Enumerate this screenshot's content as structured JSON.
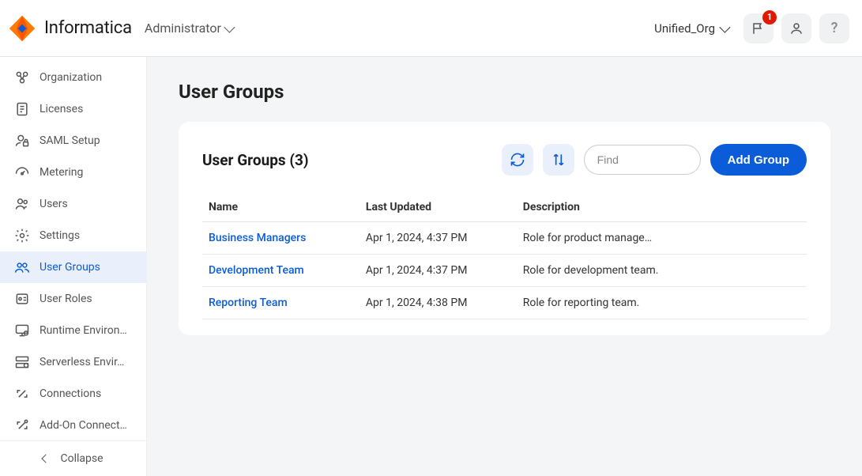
{
  "brand": "Informatica",
  "app_name": "Administrator",
  "org_name": "Unified_Org",
  "notifications_count": "1",
  "sidebar": {
    "items": [
      {
        "label": "Organization",
        "icon": "org-icon"
      },
      {
        "label": "Licenses",
        "icon": "license-icon"
      },
      {
        "label": "SAML Setup",
        "icon": "saml-icon"
      },
      {
        "label": "Metering",
        "icon": "metering-icon"
      },
      {
        "label": "Users",
        "icon": "users-icon"
      },
      {
        "label": "Settings",
        "icon": "settings-icon"
      },
      {
        "label": "User Groups",
        "icon": "groups-icon"
      },
      {
        "label": "User Roles",
        "icon": "roles-icon"
      },
      {
        "label": "Runtime Environ…",
        "icon": "runtime-icon"
      },
      {
        "label": "Serverless Envir…",
        "icon": "serverless-icon"
      },
      {
        "label": "Connections",
        "icon": "connections-icon"
      },
      {
        "label": "Add-On Connect…",
        "icon": "addon-icon"
      }
    ],
    "active_index": 6,
    "collapse_label": "Collapse"
  },
  "page": {
    "title": "User Groups",
    "card_title": "User Groups (3)",
    "find_placeholder": "Find",
    "add_button": "Add Group",
    "columns": {
      "name": "Name",
      "updated": "Last Updated",
      "description": "Description"
    },
    "rows": [
      {
        "name": "Business Managers",
        "updated": "Apr 1, 2024, 4:37 PM",
        "description": "Role for product manage…"
      },
      {
        "name": "Development Team",
        "updated": "Apr 1, 2024, 4:37 PM",
        "description": "Role for development team."
      },
      {
        "name": "Reporting Team",
        "updated": "Apr 1, 2024, 4:38 PM",
        "description": "Role for reporting team."
      }
    ]
  }
}
